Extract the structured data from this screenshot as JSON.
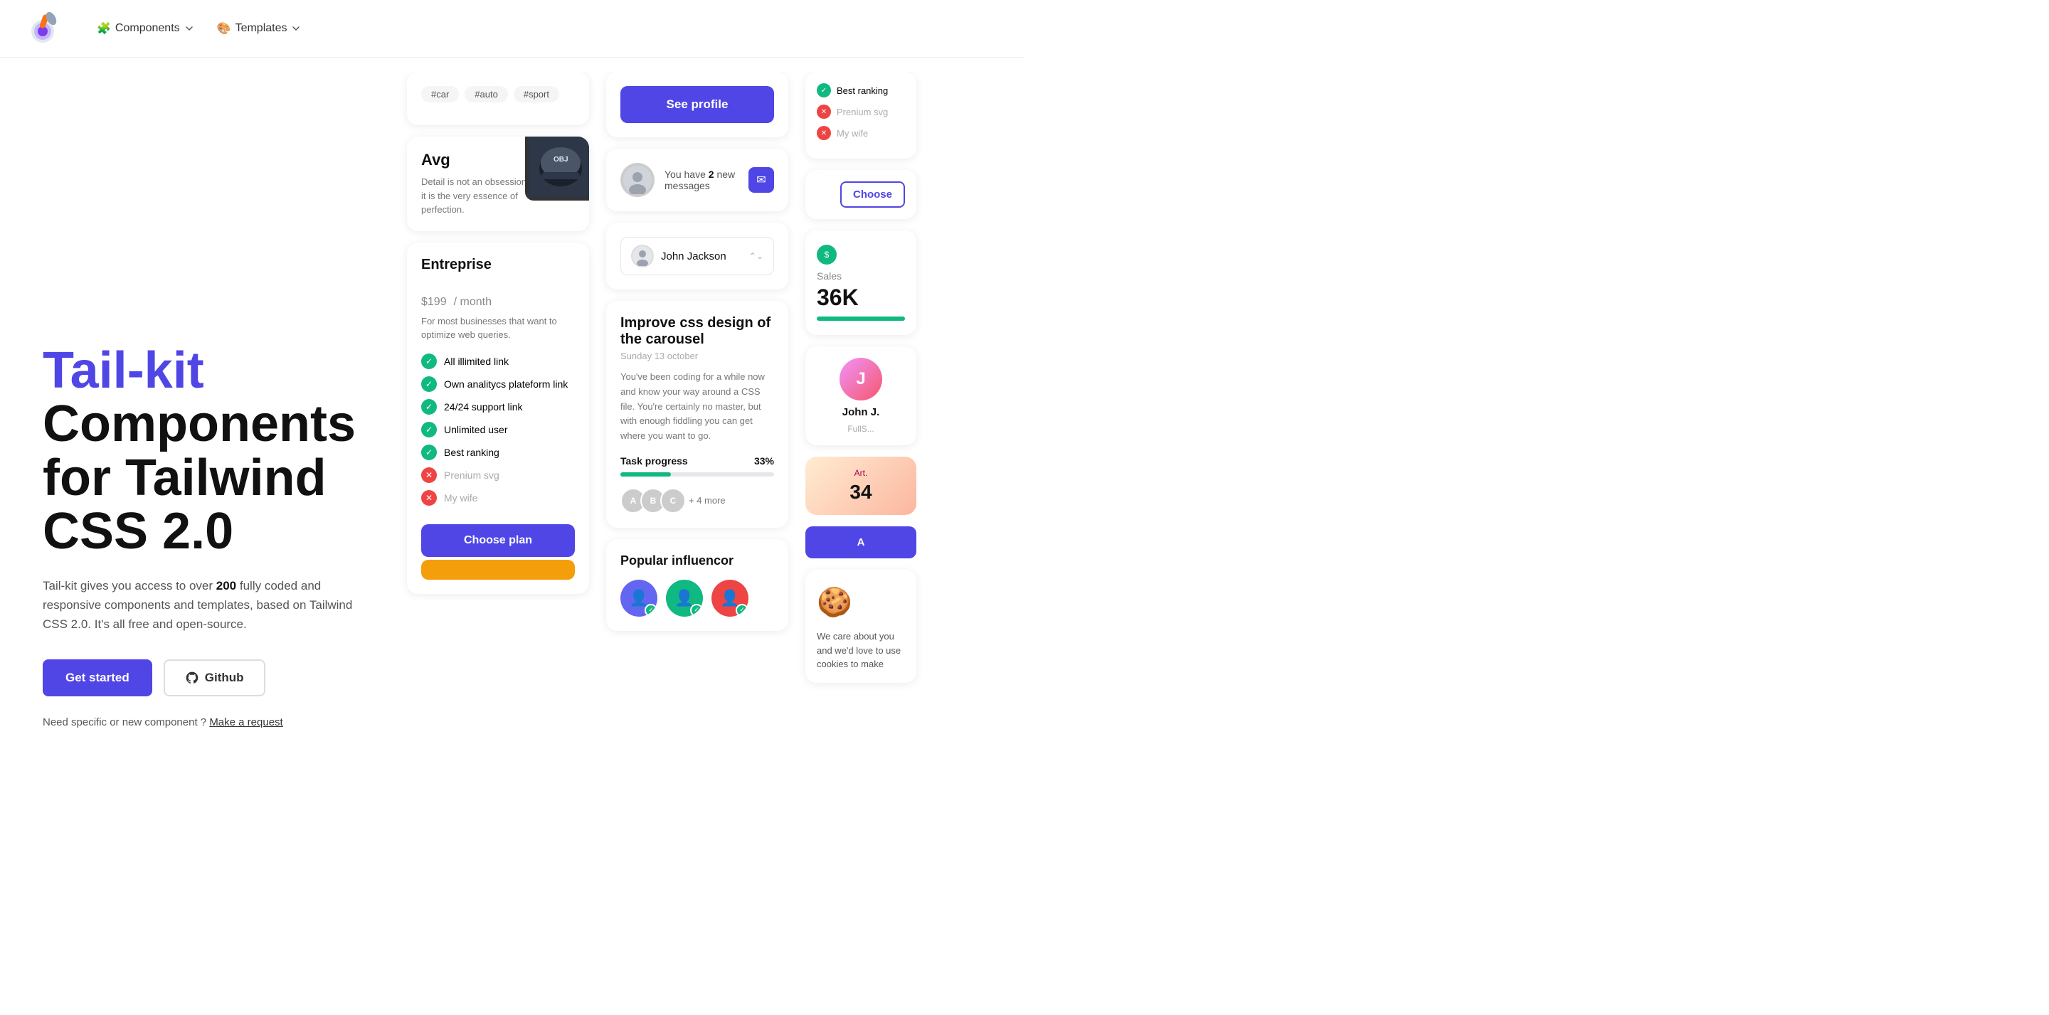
{
  "nav": {
    "components_label": "Components",
    "templates_label": "Templates"
  },
  "hero": {
    "title_blue": "Tail-kit",
    "title_dark": "Components for Tailwind CSS 2.0",
    "subtitle": "Tail-kit gives you access to over 200 fully coded and responsive components and templates, based on Tailwind CSS 2.0. It's all free and open-source.",
    "subtitle_bold": "200",
    "get_started": "Get started",
    "github": "Github",
    "cta_text": "Need specific or new component ?",
    "cta_link": "Make a request"
  },
  "pricing_card": {
    "tier": "Entreprise",
    "price": "$199",
    "period": "/ month",
    "description": "For most businesses that want to optimize web queries.",
    "features": [
      {
        "label": "All illimited link",
        "enabled": true
      },
      {
        "label": "Own analitycs plateform link",
        "enabled": true
      },
      {
        "label": "24/24 support link",
        "enabled": true
      },
      {
        "label": "Unlimited user",
        "enabled": true
      },
      {
        "label": "Best ranking",
        "enabled": true
      },
      {
        "label": "Prenium svg",
        "enabled": false
      },
      {
        "label": "My wife",
        "enabled": false
      }
    ],
    "cta": "Choose plan"
  },
  "tags": [
    "#car",
    "#auto",
    "#sport"
  ],
  "avg_card": {
    "label": "Avg",
    "text": "Detail is not an obsession, it is the very essence of perfection."
  },
  "profile_card": {
    "see_profile": "See profile",
    "message_text_pre": "You have ",
    "message_count": "2",
    "message_text_post": " new messages",
    "user_name": "John Jackson"
  },
  "task_card": {
    "title": "Improve css design of the carousel",
    "date": "Sunday 13 october",
    "description": "You've been coding for a while now and know your way around a CSS file. You're certainly no master, but with enough fiddling you can get where you want to go.",
    "progress_label": "Task progress",
    "progress_pct": "33%",
    "progress_value": 33,
    "more_count": "+ 4 more"
  },
  "popular_section": {
    "title": "Popular influencor"
  },
  "right_panel": {
    "best_ranking": "Best ranking",
    "premium_svg": "Prenium svg",
    "my_wife": "My wife",
    "choose_label": "Choose",
    "sales_label": "Sales",
    "sales_value": "36K",
    "john_name": "John J.",
    "john_role": "FullS...",
    "art_label": "Art.",
    "art_value": "34",
    "cookie_text": "We care about you and we'd love to use cookies to make"
  }
}
